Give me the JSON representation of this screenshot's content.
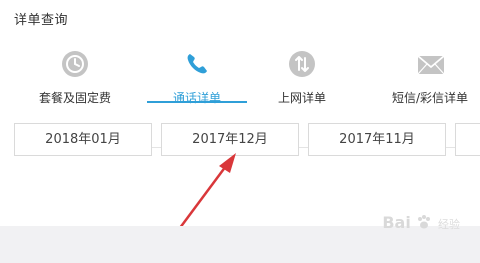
{
  "page": {
    "title": "详单查询"
  },
  "tabs": [
    {
      "label": "套餐及固定费",
      "icon": "clock-icon",
      "active": false
    },
    {
      "label": "通话详单",
      "icon": "phone-icon",
      "active": true
    },
    {
      "label": "上网详单",
      "icon": "data-transfer-icon",
      "active": false
    },
    {
      "label": "短信/彩信详单",
      "icon": "envelope-icon",
      "active": false
    }
  ],
  "months": [
    "2018年01月",
    "2017年12月",
    "2017年11月"
  ],
  "colors": {
    "accent": "#2f9fd8",
    "arrow": "#d9373a",
    "icon_gray": "#c4c4c4"
  },
  "watermark": {
    "text": "Bai",
    "sub": "经验"
  }
}
